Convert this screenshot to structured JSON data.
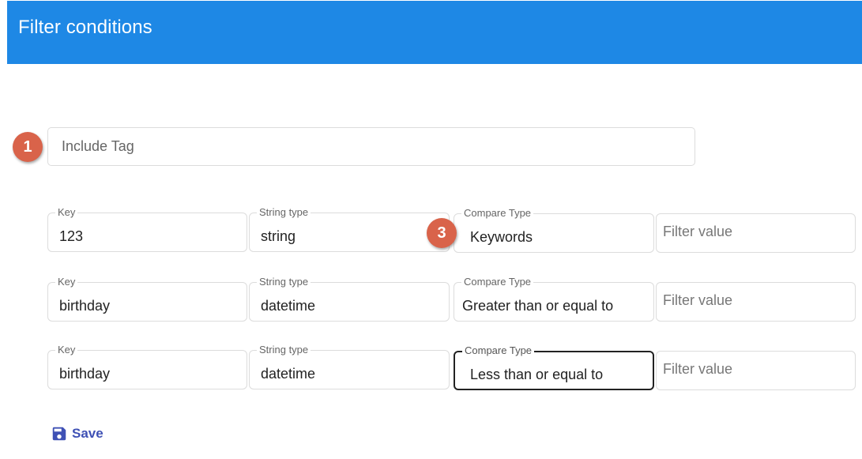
{
  "header": {
    "title": "Filter conditions"
  },
  "badges": {
    "first": "1",
    "second": "3"
  },
  "tag_input": {
    "placeholder": "Include Tag"
  },
  "rows": [
    {
      "key": {
        "label": "Key",
        "value": "123"
      },
      "string_type": {
        "label": "String type",
        "value": "string"
      },
      "compare_type": {
        "label": "Compare Type",
        "value": "Keywords"
      },
      "filter_value": {
        "placeholder": "Filter value"
      }
    },
    {
      "key": {
        "label": "Key",
        "value": "birthday"
      },
      "string_type": {
        "label": "String type",
        "value": "datetime"
      },
      "compare_type": {
        "label": "Compare Type",
        "value": "Greater than or equal to"
      },
      "filter_value": {
        "placeholder": "Filter value"
      }
    },
    {
      "key": {
        "label": "Key",
        "value": "birthday"
      },
      "string_type": {
        "label": "String type",
        "value": "datetime"
      },
      "compare_type": {
        "label": "Compare Type",
        "value": "Less than or equal to"
      },
      "filter_value": {
        "placeholder": "Filter value"
      }
    }
  ],
  "save": {
    "label": "Save",
    "icon": "floppy-disk-icon"
  },
  "colors": {
    "header": "#1e88e5",
    "badge": "#d9634a",
    "save": "#3f51b5"
  }
}
